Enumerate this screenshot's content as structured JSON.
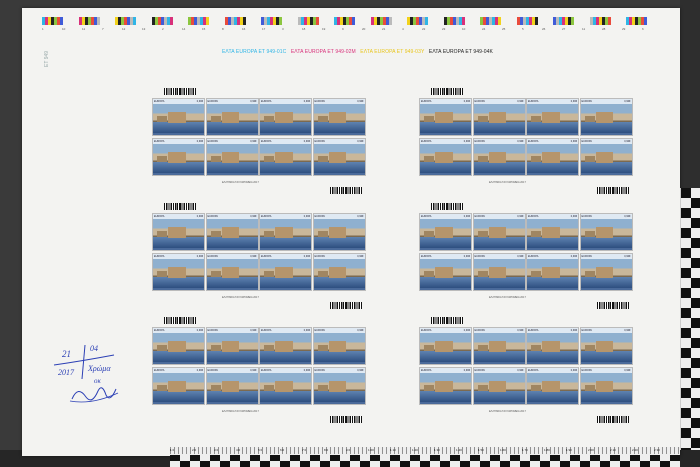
{
  "colors": {
    "cyan": "#2fb5e6",
    "magenta": "#d8307a",
    "yellow": "#f2d21b",
    "black": "#222222",
    "handwriting_ink": "#2b3fb5"
  },
  "colorbar": {
    "numbers": [
      "1",
      "10",
      "11",
      "7",
      "12",
      "13",
      "2",
      "14",
      "15",
      "8",
      "16",
      "17",
      "3",
      "18",
      "19",
      "9",
      "20",
      "21",
      "4",
      "22",
      "23",
      "10",
      "24",
      "25",
      "5",
      "26",
      "27",
      "11",
      "28",
      "29",
      "6"
    ]
  },
  "sheet_title": {
    "cyan": "ΕΛΤΑ EUROPA ET 949-01C",
    "magenta": "ΕΛΤΑ EUROPA ET 949-02M",
    "yellow": "ΕΛΤΑ EUROPA ET 949-03Y",
    "black": "ΕΛΤΑ EUROPA ET 949-04K"
  },
  "pencil_note": "ΕΤ 949",
  "stamp": {
    "left_label": "EUROPA",
    "right_label": "0,90€"
  },
  "block_footer": "ΕΛΛΗΝΙΚΑ ΤΑΧΥΔΡΟΜΕΙΑ 2017",
  "handwriting": {
    "day": "21",
    "month": "04",
    "year": "2017",
    "word": "Χρώμα",
    "note": "οκ"
  },
  "ruler_labels": [
    "1 0",
    "2 0",
    "3 0",
    "4 0",
    "5 0",
    "6 0",
    "7 0",
    "8 0",
    "9 0",
    "1 00",
    "1 10",
    "1 20",
    "1 30",
    "1 40",
    "1 50",
    "1 60",
    "1 70",
    "1 80",
    "1 90",
    "2 00",
    "2 10",
    "2 20",
    "2 30"
  ]
}
